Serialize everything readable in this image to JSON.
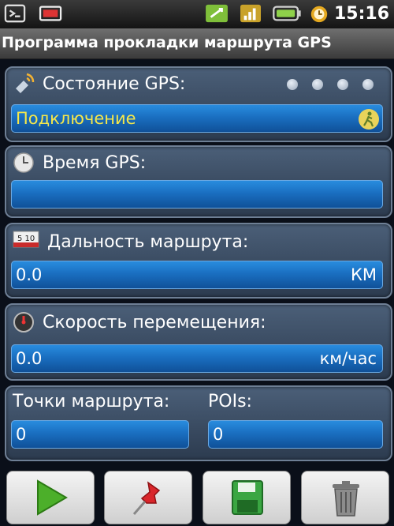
{
  "status_bar": {
    "time": "15:16"
  },
  "title": "Программа прокладки маршрута GPS",
  "gps_status": {
    "label": "Состояние GPS:",
    "value": "Подключение"
  },
  "gps_time": {
    "label": "Время GPS:",
    "value": ""
  },
  "route_distance": {
    "label": "Дальность маршрута:",
    "value": "0.0",
    "unit": "КМ"
  },
  "speed": {
    "label": "Скорость перемещения:",
    "value": "0.0",
    "unit": "км/час"
  },
  "route_points": {
    "label": "Точки маршрута:",
    "value": "0"
  },
  "pois": {
    "label": "POIs:",
    "value": "0"
  },
  "colors": {
    "accent": "#1a6fc1",
    "status_text": "#f6e84a",
    "panel": "#3a4c63"
  }
}
